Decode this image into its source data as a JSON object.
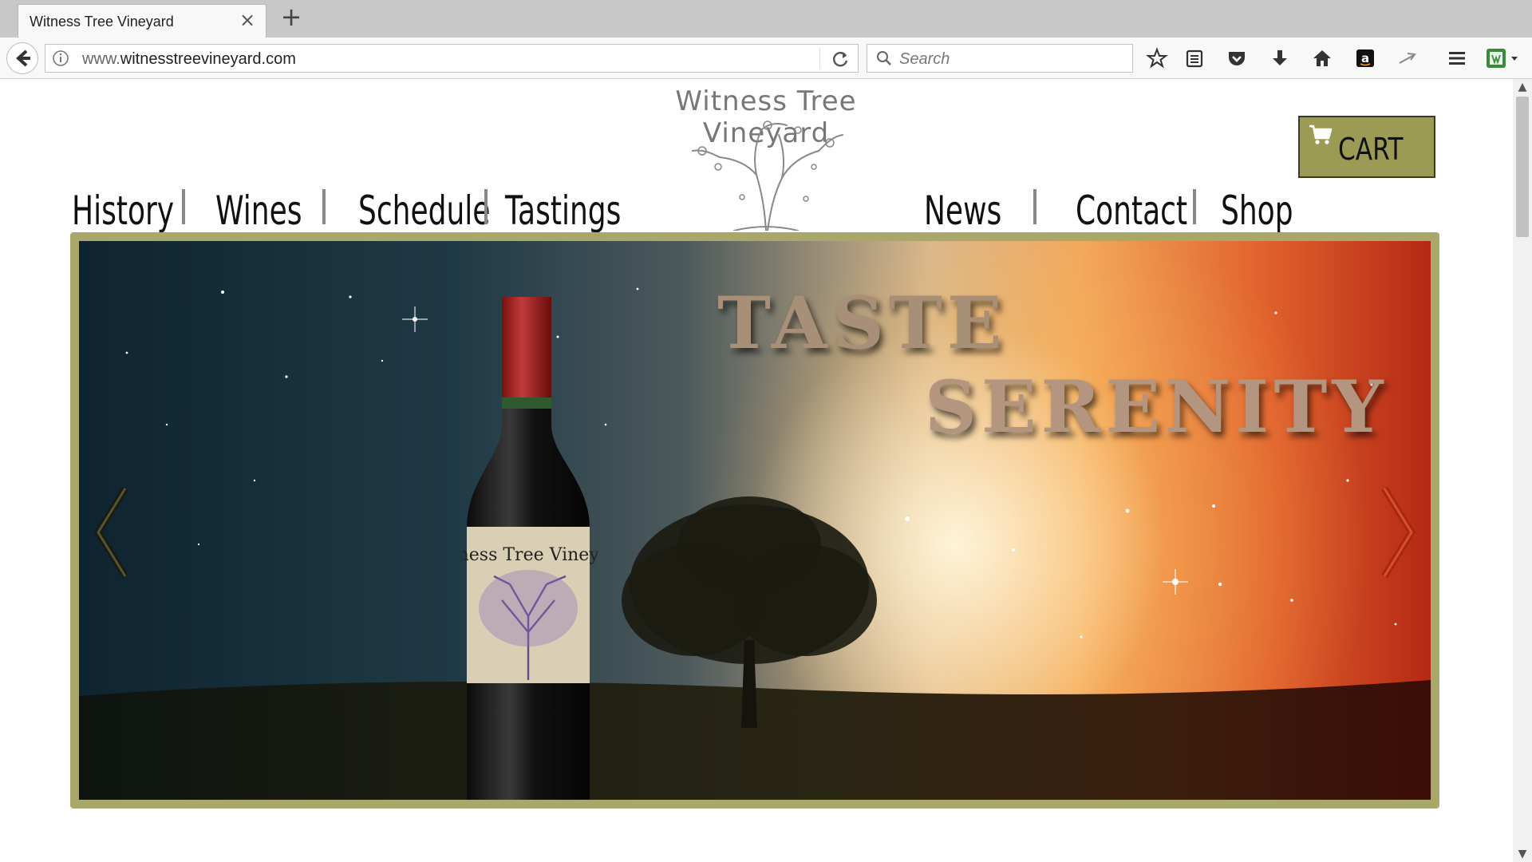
{
  "browser": {
    "tab_title": "Witness Tree Vineyard",
    "url_prefix": "www.",
    "url_domain": "witnesstreevineyard.com",
    "search_placeholder": "Search"
  },
  "site": {
    "logo_text": "Witness Tree Vineyard",
    "cart_label": "CART",
    "nav_left": [
      "History",
      "Wines",
      "Schedule",
      "Tastings"
    ],
    "nav_right": [
      "News",
      "Contact",
      "Shop"
    ],
    "hero": {
      "headline_1": "TASTE",
      "headline_2": "SERENITY",
      "bottle_label_text": "Witness Tree Vineyard"
    }
  },
  "colors": {
    "frame_olive": "#a9a86a",
    "cart_olive": "#9b9b55"
  }
}
